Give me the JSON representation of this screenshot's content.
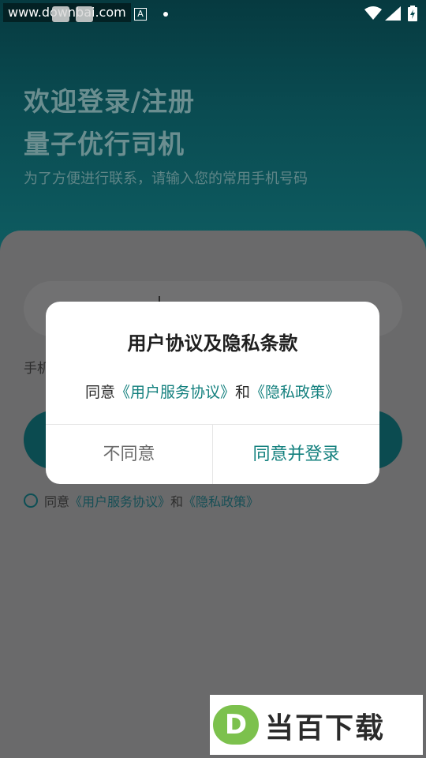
{
  "status_bar": {
    "watermark": "www.downbai.com",
    "a_badge": "A",
    "icons": [
      "wifi-icon",
      "signal-icon",
      "battery-icon"
    ]
  },
  "hero": {
    "title_line1": "欢迎登录/注册",
    "title_line2": "量子优行司机",
    "subtitle": "为了方便进行联系，请输入您的常用手机号码"
  },
  "form": {
    "hint_partial": "手机"
  },
  "agreement_row": {
    "prefix": "同意",
    "link1": "《用户服务协议》",
    "and": "和",
    "link2": "《隐私政策》"
  },
  "dialog": {
    "title": "用户协议及隐私条款",
    "body_prefix": "同意",
    "link1": "《用户服务协议》",
    "and": "和",
    "link2": "《隐私政策》",
    "disagree_label": "不同意",
    "agree_label": "同意并登录"
  },
  "bottom_watermark": {
    "logo_letter": "D",
    "text": "当百下载"
  },
  "colors": {
    "brand_teal": "#13807e",
    "header_dark": "#063a40"
  }
}
